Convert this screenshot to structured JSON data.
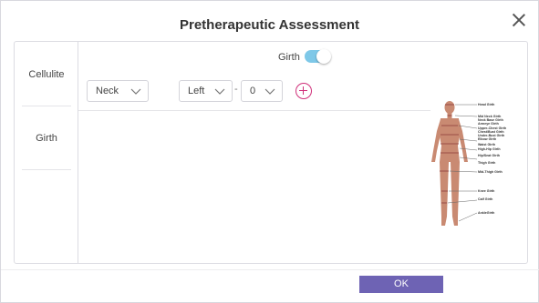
{
  "dialog": {
    "title": "Pretherapeutic Assessment"
  },
  "sidebar": {
    "items": [
      {
        "label": "Cellulite"
      },
      {
        "label": "Girth"
      }
    ]
  },
  "girth_toggle": {
    "label": "Girth",
    "on": true
  },
  "measure_row": {
    "area": "Neck",
    "separator": "-",
    "side": "Left",
    "value": "0"
  },
  "figure_labels": [
    "Head Girth",
    "Mid Neck Girth",
    "Neck Base Girth",
    "Armeye Girth",
    "Upper-Chest Girth",
    "Chest/Bust Girth",
    "Under-Bust Girth",
    "Elbow Girth",
    "Waist Girth",
    "High-Hip Girth",
    "Hip/Seat Girth",
    "Thigh Girth",
    "Mid-Thigh Girth",
    "Knee Girth",
    "Calf Girth",
    "AnkleGirth"
  ],
  "footer": {
    "ok_label": "OK"
  },
  "colors": {
    "accent": "#6e63b4",
    "toggle": "#7ec8e8",
    "add": "#d0307a"
  }
}
